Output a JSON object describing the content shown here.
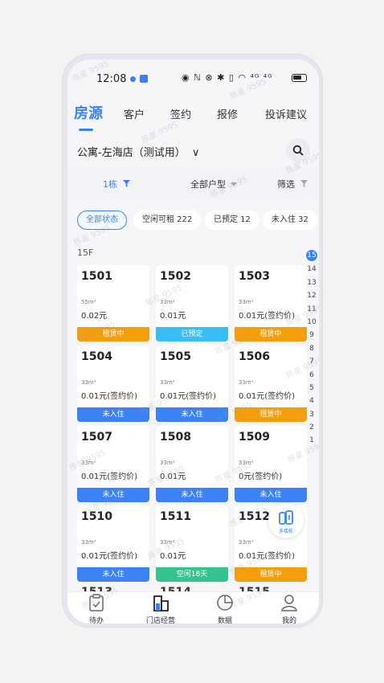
{
  "status_bar": {
    "time": "12:08",
    "icons_text": "◉ ℕ ⊗ ✱ ▯ ◠ ⁴ᴳ ⁴ᴳ"
  },
  "tabs": [
    "房源",
    "客户",
    "签约",
    "报修",
    "投诉建议"
  ],
  "store": {
    "name": "公寓-左海店（测试用）",
    "dropdown_glyph": "∨"
  },
  "filters": {
    "building": "1栋",
    "unit_type": "全部户型",
    "screen": "筛选"
  },
  "status_chips": [
    "全部状态",
    "空闲可租 222",
    "已预定 12",
    "未入住 32"
  ],
  "floor": "15F",
  "status_colors": {
    "renting": "#f59e0b",
    "reserved": "#38bdf8",
    "not_moved_in": "#3b82f6",
    "vacant": "#34c38f"
  },
  "rooms": [
    {
      "number": "1501",
      "area": "55m²",
      "price": "0.02元",
      "status": "租赁中"
    },
    {
      "number": "1502",
      "area": "33m²",
      "price": "0.01元",
      "status": "已预定"
    },
    {
      "number": "1503",
      "area": "33m²",
      "price": "0.01元(签约价)",
      "status": "租赁中"
    },
    {
      "number": "1504",
      "area": "33m²",
      "price": "0.01元(签约价)",
      "status": "未入住"
    },
    {
      "number": "1505",
      "area": "33m²",
      "price": "0.01元(签约价)",
      "status": "未入住"
    },
    {
      "number": "1506",
      "area": "33m²",
      "price": "0.01元(签约价)",
      "status": "租赁中"
    },
    {
      "number": "1507",
      "area": "33m²",
      "price": "0.01元(签约价)",
      "status": "未入住"
    },
    {
      "number": "1508",
      "area": "33m²",
      "price": "0.01元",
      "status": "未入住"
    },
    {
      "number": "1509",
      "area": "33m²",
      "price": "0元(签约价)",
      "status": "未入住"
    },
    {
      "number": "1510",
      "area": "33m²",
      "price": "0.01元(签约价)",
      "status": "未入住"
    },
    {
      "number": "1511",
      "area": "33m²",
      "price": "0.01元",
      "status": "空闲18天"
    },
    {
      "number": "1512",
      "area": "33m²",
      "price": "0.01元(签约价)",
      "status": "租赁中"
    }
  ],
  "partial_rooms": [
    "1513",
    "1514",
    "1515"
  ],
  "floor_index": [
    "15",
    "14",
    "13",
    "12",
    "11",
    "10",
    "9",
    "8",
    "7",
    "6",
    "5",
    "4",
    "3",
    "2",
    "1"
  ],
  "multi_building_label": "多楼栋",
  "bottom_nav": [
    "待办",
    "门店经营",
    "数据",
    "我的"
  ],
  "watermark": "陈星 9595"
}
